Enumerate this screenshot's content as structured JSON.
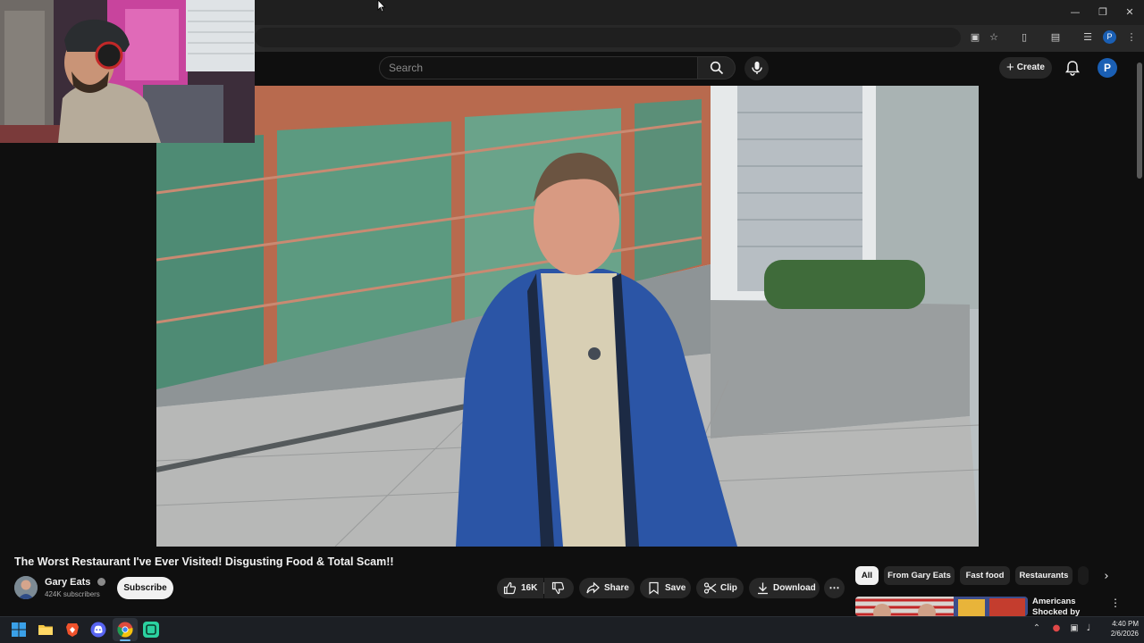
{
  "browser": {
    "window_controls": [
      "minimize",
      "restore",
      "close"
    ],
    "profile_initial": "P"
  },
  "youtube": {
    "search_placeholder": "Search",
    "create_label": "Create",
    "avatar_initial": "P"
  },
  "video": {
    "title": "The Worst Restaurant I've Ever Visited! Disgusting Food & Total Scam!!",
    "channel": {
      "name": "Gary Eats",
      "subscribers": "424K subscribers",
      "verified": true
    },
    "subscribe_label": "Subscribe",
    "actions": {
      "likes": "16K",
      "share": "Share",
      "save": "Save",
      "clip": "Clip",
      "download": "Download"
    }
  },
  "sidebar": {
    "chips": [
      "All",
      "From Gary Eats",
      "Fast food",
      "Restaurants"
    ],
    "active_chip": "All",
    "recommended": [
      {
        "title": "Americans Shocked by"
      }
    ]
  },
  "taskbar": {
    "apps": [
      "windows-start",
      "file-explorer",
      "brave",
      "discord",
      "chrome",
      "app"
    ],
    "time": "4:40 PM",
    "date": "2/6/2026"
  },
  "colors": {
    "background": "#0f0f0f",
    "accent_blue": "#1a5fb4",
    "pill_bg": "#272727"
  }
}
